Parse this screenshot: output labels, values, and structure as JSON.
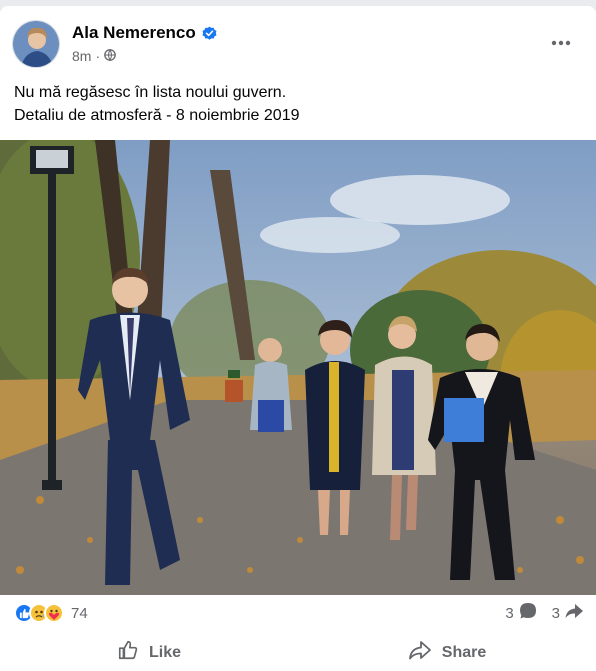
{
  "post": {
    "author": "Ala Nemerenco",
    "time": "8m",
    "text_lines": [
      "Nu mă regăsesc în lista noului guvern.",
      "Detaliu de atmosferă - 8 noiembrie 2019"
    ],
    "photo_icon": "group-walking-photo"
  },
  "icons": {
    "verified": "verified-badge-icon",
    "privacy": "globe-icon",
    "more": "more-options-icon",
    "reactions": [
      "like-reaction-icon",
      "sad-reaction-icon",
      "care-reaction-icon"
    ],
    "comment": "comment-icon",
    "share_count": "share-icon",
    "like_action": "thumbs-up-icon",
    "share_action": "share-arrow-icon"
  },
  "stats": {
    "reaction_count": "74",
    "comment_count": "3",
    "share_count": "3"
  },
  "actions": {
    "like_label": "Like",
    "share_label": "Share"
  },
  "colors": {
    "brand_blue": "#1877f2",
    "secondary_text": "#65676b"
  }
}
